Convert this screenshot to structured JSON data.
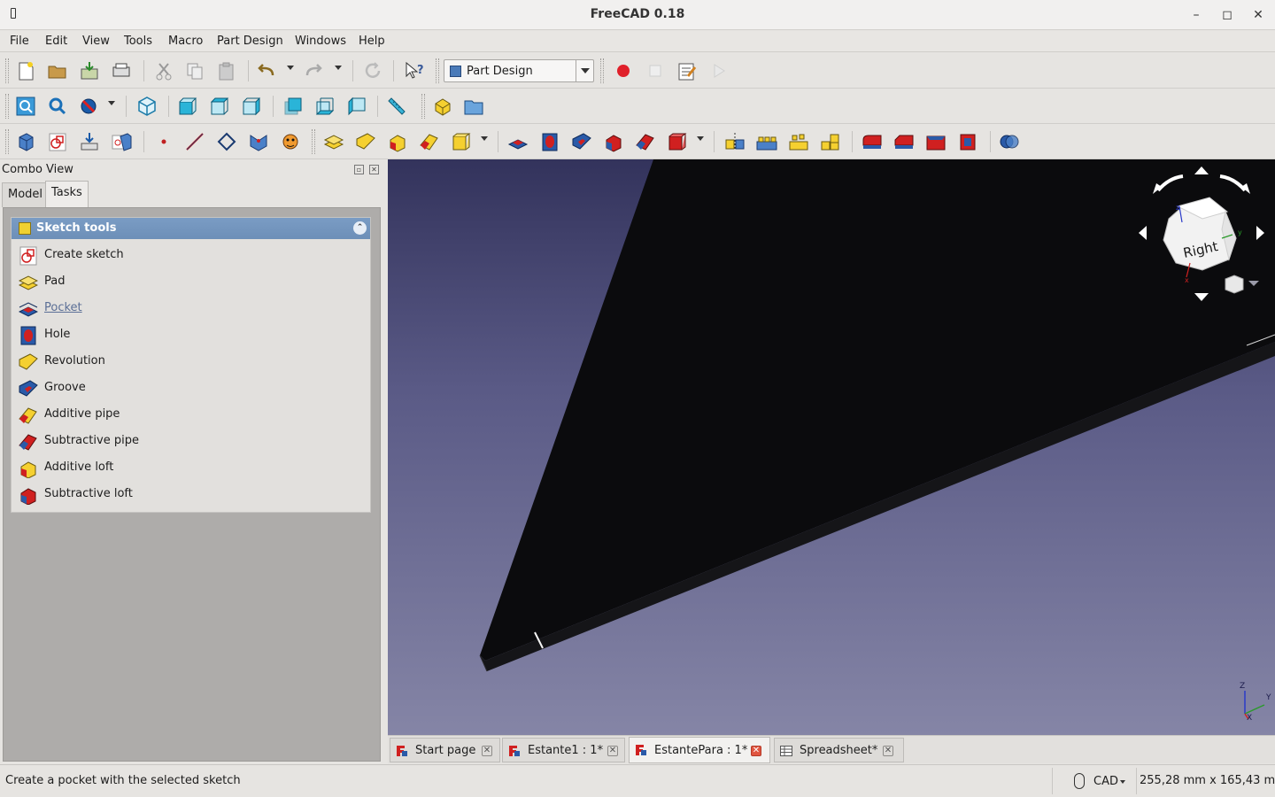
{
  "window": {
    "title": "FreeCAD 0.18"
  },
  "menu": [
    "File",
    "Edit",
    "View",
    "Tools",
    "Macro",
    "Part Design",
    "Windows",
    "Help"
  ],
  "workbench": {
    "selected": "Part Design"
  },
  "combo_view": {
    "title": "Combo View",
    "tabs": [
      "Model",
      "Tasks"
    ],
    "active_tab": "Tasks",
    "sketch_tools": {
      "title": "Sketch tools",
      "items": [
        {
          "label": "Create sketch",
          "icon": "create-sketch-icon"
        },
        {
          "label": "Pad",
          "icon": "pad-icon"
        },
        {
          "label": "Pocket",
          "icon": "pocket-icon",
          "hovered": true
        },
        {
          "label": "Hole",
          "icon": "hole-icon"
        },
        {
          "label": "Revolution",
          "icon": "revolution-icon"
        },
        {
          "label": "Groove",
          "icon": "groove-icon"
        },
        {
          "label": "Additive pipe",
          "icon": "additive-pipe-icon"
        },
        {
          "label": "Subtractive pipe",
          "icon": "subtractive-pipe-icon"
        },
        {
          "label": "Additive loft",
          "icon": "additive-loft-icon"
        },
        {
          "label": "Subtractive loft",
          "icon": "subtractive-loft-icon"
        }
      ]
    }
  },
  "navcube": {
    "face": "Right",
    "axis_labels": {
      "x": "x",
      "y": "y",
      "z": "z"
    }
  },
  "axis_cross": {
    "x": "X",
    "y": "Y",
    "z": "Z"
  },
  "doc_tabs": [
    {
      "label": "Start page",
      "active": false
    },
    {
      "label": "Estante1 : 1*",
      "active": false
    },
    {
      "label": "EstantePara : 1*",
      "active": true
    },
    {
      "label": "Spreadsheet*",
      "active": false
    }
  ],
  "status": {
    "message": "Create a pocket with the selected sketch",
    "navigation_style": "CAD",
    "dimensions": "255,28 mm x 165,43 mm"
  },
  "colors": {
    "sketch_header": "#6d8fb8",
    "view_top": "#33335c",
    "view_bottom": "#8585a6",
    "model": "#0b0b0d"
  }
}
